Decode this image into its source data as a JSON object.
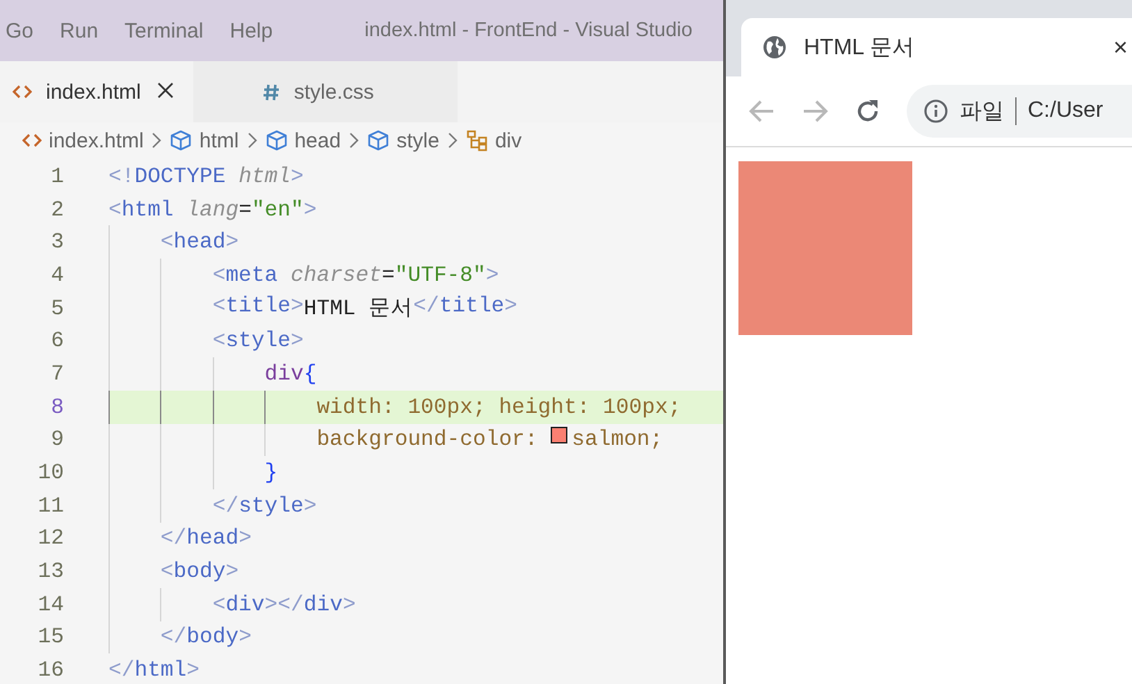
{
  "editor": {
    "menu": [
      "Go",
      "Run",
      "Terminal",
      "Help"
    ],
    "title": "index.html - FrontEnd - Visual Studio",
    "tabs": [
      {
        "label": "index.html",
        "kind": "html",
        "selected": true
      },
      {
        "label": "style.css",
        "kind": "css",
        "selected": false
      }
    ],
    "breadcrumb": [
      {
        "label": "index.html",
        "kind": "html"
      },
      {
        "label": "html",
        "kind": "element"
      },
      {
        "label": "head",
        "kind": "element"
      },
      {
        "label": "style",
        "kind": "element"
      },
      {
        "label": "div",
        "kind": "selector"
      }
    ],
    "lines": [
      {
        "number": "1",
        "highlighted": false,
        "tokens": [
          {
            "kind": "bracket",
            "text": "<!"
          },
          {
            "kind": "tag",
            "text": "DOCTYPE "
          },
          {
            "kind": "attr",
            "text": "html"
          },
          {
            "kind": "bracket",
            "text": ">"
          }
        ]
      },
      {
        "number": "2",
        "highlighted": false,
        "tokens": [
          {
            "kind": "bracket",
            "text": "<"
          },
          {
            "kind": "tag",
            "text": "html "
          },
          {
            "kind": "attr",
            "text": "lang"
          },
          {
            "kind": "plain",
            "text": "="
          },
          {
            "kind": "string",
            "text": "\"en\""
          },
          {
            "kind": "bracket",
            "text": ">"
          }
        ],
        "children": [
          {
            "number": "3",
            "highlighted": false,
            "tokens": [
              {
                "kind": "bracket",
                "text": "<"
              },
              {
                "kind": "tag",
                "text": "head"
              },
              {
                "kind": "bracket",
                "text": ">"
              }
            ],
            "children": [
              {
                "number": "4",
                "highlighted": false,
                "tokens": [
                  {
                    "kind": "bracket",
                    "text": "<"
                  },
                  {
                    "kind": "tag",
                    "text": "meta "
                  },
                  {
                    "kind": "attr",
                    "text": "charset"
                  },
                  {
                    "kind": "plain",
                    "text": "="
                  },
                  {
                    "kind": "string",
                    "text": "\"UTF-8\""
                  },
                  {
                    "kind": "bracket",
                    "text": ">"
                  }
                ]
              },
              {
                "number": "5",
                "highlighted": false,
                "tokens": [
                  {
                    "kind": "bracket",
                    "text": "<"
                  },
                  {
                    "kind": "tag",
                    "text": "title"
                  },
                  {
                    "kind": "bracket",
                    "text": ">"
                  },
                  {
                    "kind": "plain",
                    "text": "HTML 문서"
                  },
                  {
                    "kind": "bracket",
                    "text": "</"
                  },
                  {
                    "kind": "tag",
                    "text": "title"
                  },
                  {
                    "kind": "bracket",
                    "text": ">"
                  }
                ]
              },
              {
                "number": "6",
                "highlighted": false,
                "tokens": [
                  {
                    "kind": "bracket",
                    "text": "<"
                  },
                  {
                    "kind": "tag",
                    "text": "style"
                  },
                  {
                    "kind": "bracket",
                    "text": ">"
                  }
                ],
                "children": [
                  {
                    "number": "7",
                    "highlighted": false,
                    "tokens": [
                      {
                        "kind": "selector",
                        "text": "div"
                      },
                      {
                        "kind": "brace",
                        "text": "{"
                      }
                    ],
                    "children": [
                      {
                        "number": "8",
                        "highlighted": true,
                        "tokens": [
                          {
                            "kind": "property",
                            "text": "width: 100px; height: 100px;"
                          }
                        ]
                      },
                      {
                        "number": "9",
                        "highlighted": false,
                        "tokens": [
                          {
                            "kind": "property",
                            "text": "background-color: "
                          },
                          {
                            "kind": "swatch",
                            "color": "#fa8072"
                          },
                          {
                            "kind": "property",
                            "text": "salmon;"
                          }
                        ]
                      }
                    ]
                  },
                  {
                    "number": "10",
                    "highlighted": false,
                    "tokens": [
                      {
                        "kind": "brace",
                        "text": "}"
                      }
                    ]
                  }
                ]
              },
              {
                "number": "11",
                "highlighted": false,
                "tokens": [
                  {
                    "kind": "bracket",
                    "text": "</"
                  },
                  {
                    "kind": "tag",
                    "text": "style"
                  },
                  {
                    "kind": "bracket",
                    "text": ">"
                  }
                ]
              }
            ]
          },
          {
            "number": "12",
            "highlighted": false,
            "tokens": [
              {
                "kind": "bracket",
                "text": "</"
              },
              {
                "kind": "tag",
                "text": "head"
              },
              {
                "kind": "bracket",
                "text": ">"
              }
            ]
          },
          {
            "number": "13",
            "highlighted": false,
            "tokens": [
              {
                "kind": "bracket",
                "text": "<"
              },
              {
                "kind": "tag",
                "text": "body"
              },
              {
                "kind": "bracket",
                "text": ">"
              }
            ],
            "children": [
              {
                "number": "14",
                "highlighted": false,
                "tokens": [
                  {
                    "kind": "bracket",
                    "text": "<"
                  },
                  {
                    "kind": "tag",
                    "text": "div"
                  },
                  {
                    "kind": "bracket",
                    "text": "></"
                  },
                  {
                    "kind": "tag",
                    "text": "div"
                  },
                  {
                    "kind": "bracket",
                    "text": ">"
                  }
                ]
              }
            ]
          },
          {
            "number": "15",
            "highlighted": false,
            "tokens": [
              {
                "kind": "bracket",
                "text": "</"
              },
              {
                "kind": "tag",
                "text": "body"
              },
              {
                "kind": "bracket",
                "text": ">"
              }
            ]
          }
        ]
      },
      {
        "number": "16",
        "highlighted": false,
        "tokens": [
          {
            "kind": "bracket",
            "text": "</"
          },
          {
            "kind": "tag",
            "text": "html"
          },
          {
            "kind": "bracket",
            "text": ">"
          }
        ]
      }
    ]
  },
  "browser": {
    "tab_title": "HTML 문서",
    "close": "×",
    "address": {
      "scheme_label": "파일",
      "url": "C:/User"
    }
  }
}
